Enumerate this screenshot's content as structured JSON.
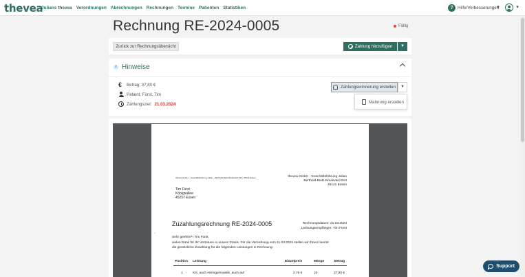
{
  "nav": {
    "logo": "thevea",
    "links": [
      "Julians thevea",
      "Verordnungen",
      "Abrechnungen",
      "Rechnungen",
      "Termine",
      "Patienten",
      "Statistiken"
    ],
    "help_badge": "?",
    "help_label": "Hilfe/Verbesserungen",
    "caret": "▼"
  },
  "header": {
    "title": "Rechnung RE-2024-0005",
    "status": "Fällig",
    "status_color": "#e0453a"
  },
  "toolbar": {
    "back_label": "Zurück zur Rechnungsübersicht",
    "pay_label": "Zahlung hinzufügen"
  },
  "hints": {
    "title": "Hinweise",
    "amount": "Betrag: 37,80 €",
    "patient": "Patient: Fürst, Tim",
    "due_label": "Zahlungsziel:",
    "due_date": "21.03.2024",
    "remind_label": "Zahlungserinnerung erstellen",
    "dropdown_item": "Mahnung erstellen"
  },
  "document": {
    "sender_line": "thevea GmbH – Geschäftsführung Julian – Berthold-Beitz-Boulevard 514 | 45141 Essen",
    "company_lines": [
      "thevea GmbH - Geschäftsführung Julian",
      "Berthold-Beitz-Boulevard 514",
      "45141 Essen"
    ],
    "recipient_lines": [
      "Tim Fürst",
      "Königsallee",
      "45257 Essen"
    ],
    "heading": "Zuzahlungsrechnung RE-2024-0005",
    "invoice_date": "Rechnungsdatum: 21.03.2024",
    "recipient_label": "Leistungsempfänger: Tim Fürst",
    "salutation": "Sehr geehrte*r Tim Fürst,",
    "body_lines": [
      "vielen Dank für Ihr Vertrauen in unsere Praxis. Für die Verordnung vom 11.03.2024 stellen wir Ihnen hiermit",
      "die gesetzliche Zuzahlung für die folgenden Leistungen in Rechnung:"
    ],
    "table_headers": [
      "Position",
      "Leistung",
      "Einzelpreis",
      "Menge",
      "Betrag"
    ],
    "rows": [
      {
        "position": "1",
        "service": "KG, auch Atemgymnastik, auch auf",
        "price": "2,78 €",
        "qty": "10",
        "amount": "27,80 €"
      }
    ]
  },
  "support": {
    "label": "Support"
  }
}
